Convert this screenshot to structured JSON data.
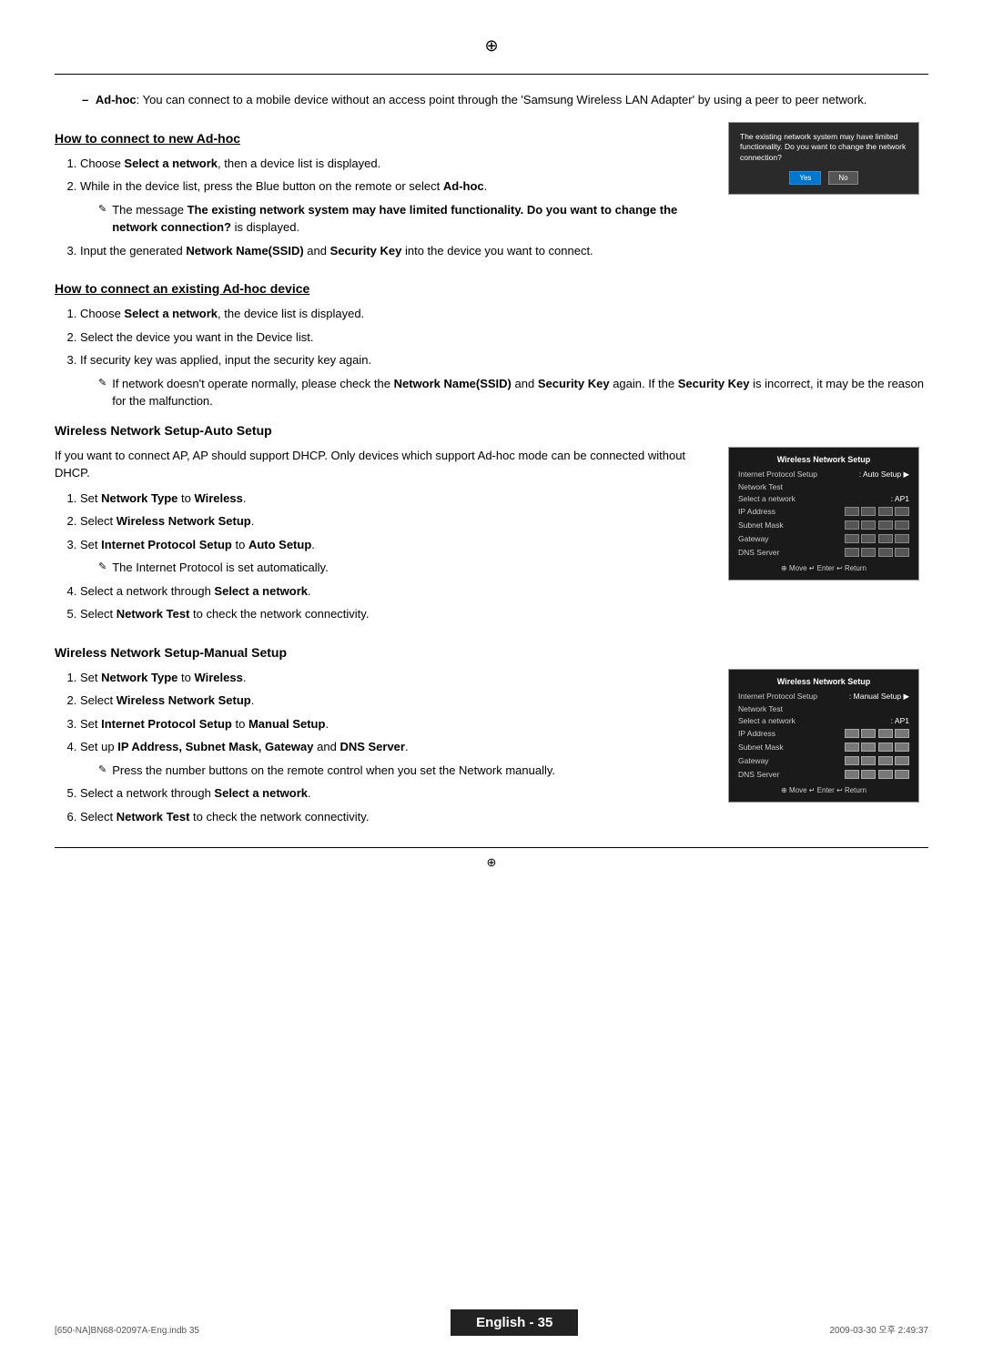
{
  "page": {
    "compass_top": "⊕",
    "compass_bottom": "⊕",
    "border": true
  },
  "footer": {
    "left_text": "[650-NA]BN68-02097A-Eng.indb  35",
    "page_label": "English - 35",
    "right_text": "2009-03-30  오후  2:49:37"
  },
  "intro": {
    "dash": "–",
    "bold_term": "Ad-hoc",
    "text": ": You can connect to a mobile device without an access point through the 'Samsung Wireless LAN Adapter' by using a peer to peer network."
  },
  "section1": {
    "heading": "How to connect to new Ad-hoc",
    "steps": [
      {
        "id": 1,
        "text_before": "Choose ",
        "bold1": "Select a network",
        "text_after": ", then a device list is displayed."
      },
      {
        "id": 2,
        "text_before": "While in the device list, press the Blue button on the remote or select ",
        "bold1": "Ad-hoc",
        "text_after": "."
      }
    ],
    "note": {
      "text_before": "The message ",
      "bold1": "The existing network system may have limited functionality. Do you want to change the network connection?",
      "text_after": " is displayed."
    },
    "step3": {
      "id": 3,
      "text_before": "Input the generated ",
      "bold1": "Network Name(SSID)",
      "text_mid": " and ",
      "bold2": "Security Key",
      "text_after": " into the device you want to connect."
    }
  },
  "section2": {
    "heading": "How to connect an existing Ad-hoc device",
    "steps": [
      {
        "id": 1,
        "text_before": "Choose ",
        "bold1": "Select a network",
        "text_after": ", the device list is displayed."
      },
      {
        "id": 2,
        "text": "Select the device you want in the Device list."
      },
      {
        "id": 3,
        "text": "If security key was applied, input the security key again."
      }
    ],
    "note": {
      "text_before": "If network doesn't operate normally, please check the ",
      "bold1": "Network Name(SSID)",
      "text_mid": " and ",
      "bold2": "Security Key",
      "text_mid2": " again. If the ",
      "bold3": "Security Key",
      "text_after": " is incorrect, it may be the reason for the malfunction."
    }
  },
  "section3": {
    "heading": "Wireless Network Setup-Auto Setup",
    "intro": "If you want to connect AP, AP should support DHCP. Only devices which support Ad-hoc mode can be connected without DHCP.",
    "steps": [
      {
        "id": 1,
        "text_before": "Set ",
        "bold1": "Network Type",
        "text_mid": " to ",
        "bold2": "Wireless",
        "text_after": "."
      },
      {
        "id": 2,
        "text_before": "Select ",
        "bold1": "Wireless Network Setup",
        "text_after": "."
      },
      {
        "id": 3,
        "text_before": "Set ",
        "bold1": "Internet Protocol Setup",
        "text_mid": " to ",
        "bold2": "Auto Setup",
        "text_after": "."
      },
      {
        "id": 4,
        "text_before": "Select a network through ",
        "bold1": "Select a network",
        "text_after": "."
      },
      {
        "id": 5,
        "text_before": "Select ",
        "bold1": "Network Test",
        "text_after": " to check the network connectivity."
      }
    ],
    "note": "The Internet Protocol is set automatically.",
    "screen": {
      "title": "Wireless Network Setup",
      "rows": [
        {
          "label": "Internet Protocol Setup",
          "value": ": Auto Setup ▶"
        },
        {
          "label": "Network Test",
          "value": ""
        },
        {
          "label": "Select a network",
          "value": ": AP1"
        },
        {
          "label": "",
          "value": ""
        },
        {
          "label": "IP Address",
          "value": "boxes"
        },
        {
          "label": "Subnet Mask",
          "value": "boxes"
        },
        {
          "label": "Gateway",
          "value": "boxes"
        },
        {
          "label": "DNS Server",
          "value": "boxes"
        }
      ],
      "footer": "⊕ Move  ↵ Enter  ↩ Return"
    }
  },
  "section4": {
    "heading": "Wireless Network Setup-Manual Setup",
    "steps": [
      {
        "id": 1,
        "text_before": "Set ",
        "bold1": "Network Type",
        "text_mid": " to ",
        "bold2": "Wireless",
        "text_after": "."
      },
      {
        "id": 2,
        "text_before": "Select ",
        "bold1": "Wireless Network Setup",
        "text_after": "."
      },
      {
        "id": 3,
        "text_before": "Set ",
        "bold1": "Internet Protocol Setup",
        "text_mid": " to ",
        "bold2": "Manual Setup",
        "text_after": "."
      },
      {
        "id": 4,
        "text_before": "Set up ",
        "bold1": "IP Address, Subnet Mask, Gateway",
        "text_mid": " and ",
        "bold2": "DNS Server",
        "text_after": "."
      },
      {
        "id": 5,
        "text_before": "Select a network through ",
        "bold1": "Select a network",
        "text_after": "."
      },
      {
        "id": 6,
        "text_before": "Select ",
        "bold1": "Network Test",
        "text_after": " to check the network connectivity."
      }
    ],
    "note": "Press the number buttons on the remote control when you set the Network manually.",
    "screen": {
      "title": "Wireless Network Setup",
      "rows": [
        {
          "label": "Internet Protocol Setup",
          "value": ": Manual Setup ▶"
        },
        {
          "label": "Network Test",
          "value": ""
        },
        {
          "label": "Select a network",
          "value": ": AP1"
        },
        {
          "label": "",
          "value": ""
        },
        {
          "label": "IP Address",
          "value": "boxes-filled"
        },
        {
          "label": "Subnet Mask",
          "value": "boxes-filled"
        },
        {
          "label": "Gateway",
          "value": "boxes-filled"
        },
        {
          "label": "DNS Server",
          "value": "boxes-filled"
        }
      ],
      "footer": "⊕ Move  ↵ Enter  ↩ Return"
    }
  },
  "dialog_screen": {
    "text": "The existing network system may have limited functionality. Do you want to change the network connection?",
    "yes_label": "Yes",
    "no_label": "No"
  }
}
